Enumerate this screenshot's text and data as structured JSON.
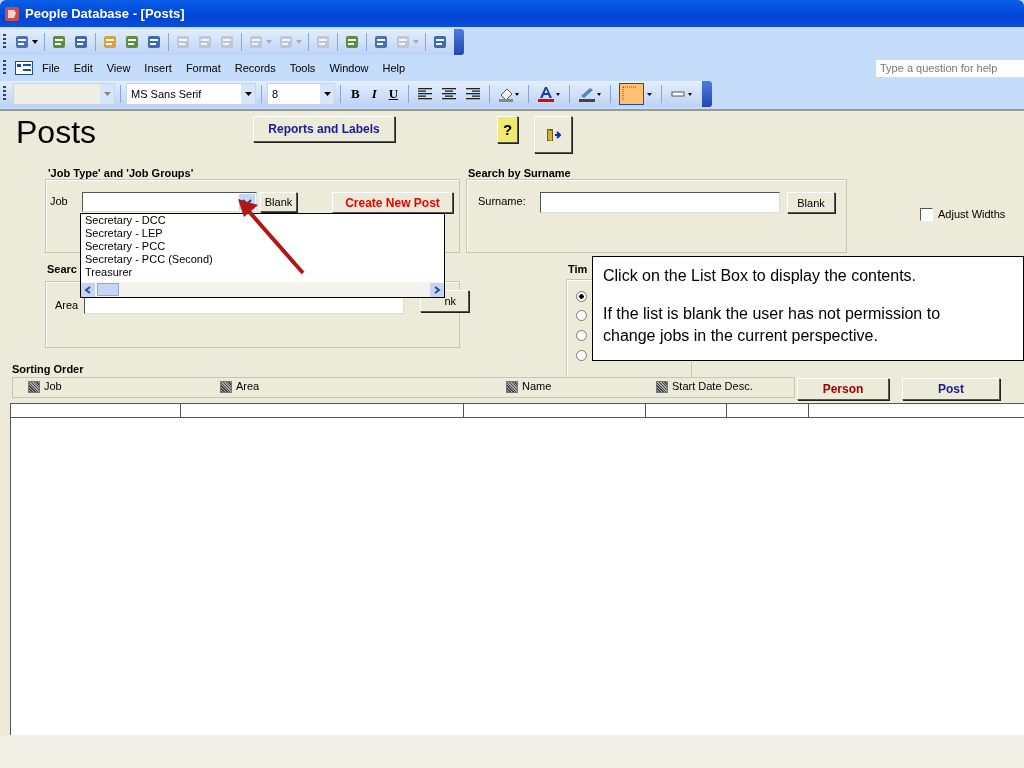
{
  "window": {
    "title": "People Database - [Posts]"
  },
  "toolbar": [
    {
      "kind": "button",
      "disabled": false,
      "dropdown": true
    },
    {
      "kind": "separator"
    },
    {
      "kind": "button",
      "disabled": false,
      "dropdown": false
    },
    {
      "kind": "button",
      "disabled": false,
      "dropdown": false
    },
    {
      "kind": "separator"
    },
    {
      "kind": "button",
      "disabled": false,
      "dropdown": false
    },
    {
      "kind": "button",
      "disabled": false,
      "dropdown": false
    },
    {
      "kind": "button",
      "disabled": false,
      "dropdown": false
    },
    {
      "kind": "separator"
    },
    {
      "kind": "button",
      "disabled": true,
      "dropdown": false
    },
    {
      "kind": "button",
      "disabled": true,
      "dropdown": false
    },
    {
      "kind": "button",
      "disabled": true,
      "dropdown": false
    },
    {
      "kind": "separator"
    },
    {
      "kind": "button",
      "disabled": true,
      "dropdown": true
    },
    {
      "kind": "button",
      "disabled": true,
      "dropdown": true
    },
    {
      "kind": "separator"
    },
    {
      "kind": "button",
      "disabled": true,
      "dropdown": false
    },
    {
      "kind": "separator"
    },
    {
      "kind": "button",
      "disabled": false,
      "dropdown": false
    },
    {
      "kind": "separator"
    },
    {
      "kind": "button",
      "disabled": false,
      "dropdown": false
    },
    {
      "kind": "button",
      "disabled": true,
      "dropdown": true
    },
    {
      "kind": "separator"
    },
    {
      "kind": "button",
      "disabled": false,
      "dropdown": false
    }
  ],
  "menu": [
    "File",
    "Edit",
    "View",
    "Insert",
    "Format",
    "Records",
    "Tools",
    "Window",
    "Help"
  ],
  "help_box": {
    "placeholder": "Type a question for help"
  },
  "format_bar": {
    "font": "MS Sans Serif",
    "size": "8",
    "buttons": [
      "B",
      "I",
      "U"
    ]
  },
  "form": {
    "title": "Posts",
    "reports_button": "Reports and Labels",
    "help_button": "?",
    "job_group": {
      "label": "'Job Type' and 'Job Groups'",
      "job_label": "Job",
      "blank_button": "Blank",
      "create_button": "Create New Post"
    },
    "job_dropdown": {
      "expanded": true,
      "options": [
        "Secretary - DCC",
        "Secretary - LEP",
        "Secretary - PCC",
        "Secretary - PCC (Second)",
        "Treasurer"
      ]
    },
    "surname_group": {
      "label": "Search by Surname",
      "field_label": "Surname:",
      "blank_button": "Blank"
    },
    "adjust_widths": {
      "label": "Adjust Widths",
      "checked": false
    },
    "area_group": {
      "label": "Searc",
      "field_label": "Area",
      "blank_button": "nk"
    },
    "time_group": {
      "label": "Tim",
      "options": [
        {
          "selected": true
        },
        {
          "selected": false
        },
        {
          "selected": false
        },
        {
          "selected": false
        }
      ]
    },
    "sorting": {
      "label": "Sorting Order",
      "options": [
        {
          "label": "Job",
          "checked": true
        },
        {
          "label": "Area",
          "checked": true
        },
        {
          "label": "Name",
          "checked": true
        },
        {
          "label": "Start Date Desc.",
          "checked": true
        }
      ],
      "person_button": "Person",
      "post_button": "Post"
    }
  },
  "callout": {
    "paragraphs": [
      "Click on the List Box to display the contents.",
      "If the list is blank the user has not permission to change jobs in the current perspective."
    ]
  }
}
